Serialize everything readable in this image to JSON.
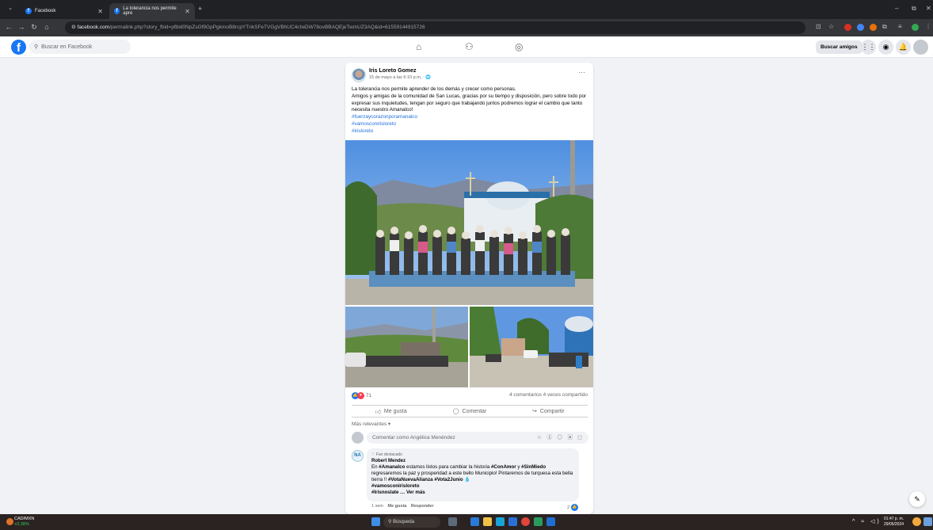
{
  "browser": {
    "tabs": [
      {
        "title": "Facebook",
        "active": false
      },
      {
        "title": "La tolerancia nos permite apre",
        "active": true
      }
    ],
    "new_tab": "+",
    "url_host": "facebook.com",
    "url_path": "/permalink.php?story_fbid=pfbid0NpZsGf9GpPgkmoB8rcpYTnkSFeTVGgVBhUC4cIwDW78ovBBAQEjeTwmUZ3AQ&id=61559144915726",
    "window_controls": [
      "–",
      "⧉",
      "✕"
    ]
  },
  "facebook": {
    "search_placeholder": "Buscar en Facebook",
    "find_friends": "Buscar amigos"
  },
  "post": {
    "author": "Iris Loreto Gomez",
    "date": "15 de mayo a las 6:10 p.m. · 🌐",
    "menu": "···",
    "body_lines": [
      "La tolerancia nos permite aprender de los demás y crecer como personas.",
      "Amigos y amigas de la comunidad de San Lucas, gracias por su tiempo y disposición, pero sobre todo por expresar sus inquietudes, tengan por seguro que trabajando juntos podremos lograr el cambio que tanto necesita nuestro Amanalco!"
    ],
    "hashtags": [
      "#fuerzaycorazonporamanalco",
      "#vamosconirisloreto",
      "#irisloreto"
    ],
    "reactions_count": "71",
    "comments_shares": "4 comentarios  4 veces compartido",
    "actions": {
      "like": "Me gusta",
      "comment": "Comentar",
      "share": "Compartir"
    },
    "sort_label": "Más relevantes ▾",
    "comment_placeholder": "Comentar como Angélica Menéndez",
    "comment_tools": "☺ ⓖ ◎ ▣ ◻"
  },
  "comment": {
    "badge": "♡ Fan destacado",
    "author": "Robert Mendez",
    "text_1_pre": "En ",
    "text_1_tag1": "#Amanalco",
    "text_1_mid": " estamos listos para cambiar la historia ",
    "text_1_tag2": "#ConAmor",
    "text_1_and": " y ",
    "text_1_tag3": "#SinMiedo",
    "text_2": "regresaremos la paz y prosperidad a este bello Municipio! Pintaremos de turquesa esta bella tierra !! ",
    "text_2_tag": "#VotaNuevaAlianza #Vota2Junio",
    "tag_line": "#vamosconirisloreto",
    "last": "#Irisnoslate … Ver más",
    "time": "1 sem",
    "like": "Me gusta",
    "reply": "Responder",
    "reaction_count": "2"
  },
  "taskbar": {
    "ticker_name": "CAD/MXN",
    "ticker_change": "+0.38%",
    "search": "Búsqueda",
    "time": "01:47 p. m.",
    "date": "29/05/2024",
    "tray": "^ ≈ ◁)"
  },
  "colors": {
    "facebook_blue": "#1877f2",
    "hashtag": "#216fdb",
    "taskbar": "#2a2321"
  }
}
